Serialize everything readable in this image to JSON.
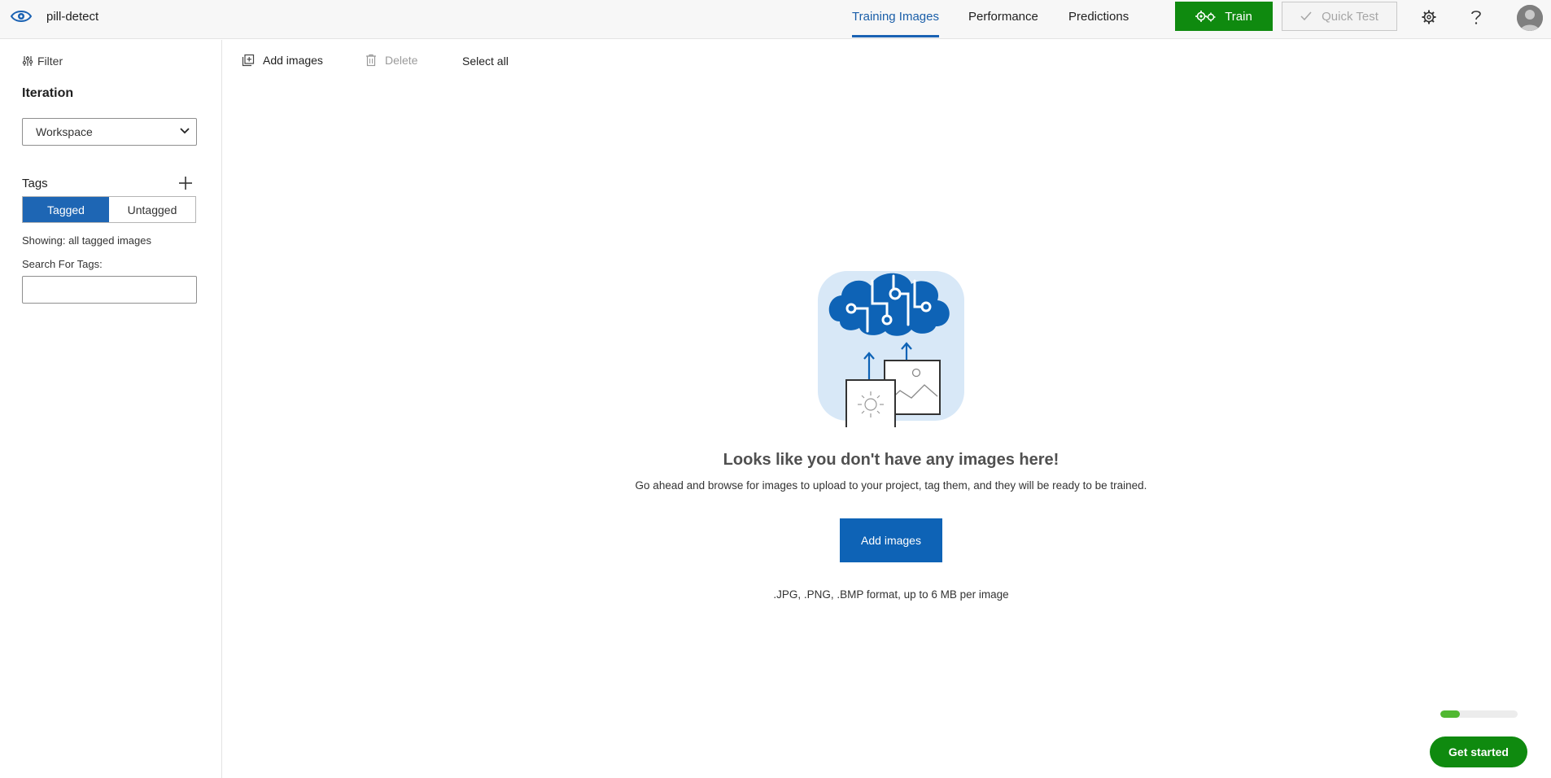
{
  "header": {
    "project_name": "pill-detect",
    "tabs": [
      {
        "label": "Training Images",
        "active": true
      },
      {
        "label": "Performance",
        "active": false
      },
      {
        "label": "Predictions",
        "active": false
      }
    ],
    "train_label": "Train",
    "quick_test_label": "Quick Test",
    "accent_color": "#0e63b6",
    "train_color": "#0f8a0f"
  },
  "sidebar": {
    "filter_label": "Filter",
    "iteration_heading": "Iteration",
    "iteration_value": "Workspace",
    "tags_heading": "Tags",
    "segment": {
      "tagged": "Tagged",
      "untagged": "Untagged",
      "selected": "Tagged"
    },
    "showing_text": "Showing: all tagged images",
    "search_label": "Search For Tags:",
    "search_value": ""
  },
  "toolbar": {
    "add_images": "Add images",
    "delete": "Delete",
    "select_all": "Select all"
  },
  "empty_state": {
    "title": "Looks like you don't have any images here!",
    "subtitle": "Go ahead and browse for images to upload to your project, tag them, and they will be ready to be trained.",
    "button": "Add images",
    "formats": ".JPG, .PNG, .BMP format, up to 6 MB per image"
  },
  "onboarding": {
    "progress_fraction": 0.25,
    "button": "Get started"
  }
}
